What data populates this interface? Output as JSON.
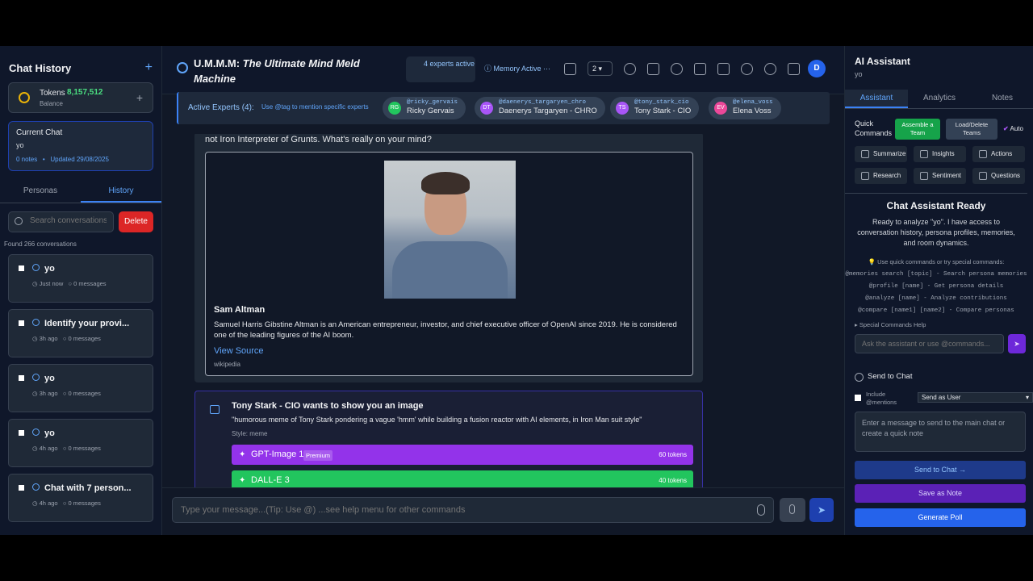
{
  "left": {
    "title": "Chat History",
    "tokens_label": "Tokens",
    "tokens_value": "8,157,512",
    "balance_label": "Balance",
    "current_chat_label": "Current Chat",
    "current_chat_name": "yo",
    "current_notes": "0 notes",
    "current_updated": "Updated 29/08/2025",
    "tab_personas": "Personas",
    "tab_history": "History",
    "search_placeholder": "Search conversations",
    "delete_label": "Delete",
    "found": "Found 266 conversations",
    "conversations": [
      {
        "title": "yo",
        "time": "Just now",
        "messages": "0 messages"
      },
      {
        "title": "Identify your provi...",
        "time": "3h ago",
        "messages": "0 messages"
      },
      {
        "title": "yo",
        "time": "3h ago",
        "messages": "0 messages"
      },
      {
        "title": "yo",
        "time": "4h ago",
        "messages": "0 messages"
      },
      {
        "title": "Chat with 7 person...",
        "time": "4h ago",
        "messages": "0 messages"
      }
    ]
  },
  "header": {
    "title_prefix": "U.M.M.M: ",
    "title_italic": "The Ultimate Mind Meld Machine",
    "experts_badge": "4 experts active",
    "memory": "Memory Active",
    "select_value": "2",
    "avatar": "D",
    "active_experts_label": "Active Experts (4):",
    "mention_hint": "Use @tag to mention specific experts",
    "experts": [
      {
        "initials": "RG",
        "tag": "@ricky_gervais",
        "name": "Ricky Gervais",
        "color": "#22c55e"
      },
      {
        "initials": "DT",
        "tag": "@daenerys_targaryen_chro",
        "name": "Daenerys Targaryen - CHRO",
        "color": "#a855f7"
      },
      {
        "initials": "TS",
        "tag": "@tony_stark_cio",
        "name": "Tony Stark - CIO",
        "color": "#a855f7"
      },
      {
        "initials": "EV",
        "tag": "@elena_voss",
        "name": "Elena Voss",
        "color": "#ec4899"
      }
    ]
  },
  "chat": {
    "msg1_text": "not Iron Interpreter of Grunts. What's really on your mind?",
    "card_name": "Sam Altman",
    "card_desc": "Samuel Harris Gibstine Altman is an American entrepreneur, investor, and chief executive officer of OpenAI since 2019. He is considered one of the leading figures of the AI boom.",
    "card_source": "View Source",
    "card_site": "wikipedia",
    "msg2_title": "Tony Stark - CIO wants to show you an image",
    "msg2_prompt": "\"humorous meme of Tony Stark pondering a vague 'hmm' while building a fusion reactor with AI elements, in Iron Man suit style\"",
    "msg2_style": "Style: meme",
    "generators": [
      {
        "name": "GPT-Image 1",
        "badge": "Premium",
        "tokens": "60 tokens",
        "color": "#9333ea"
      },
      {
        "name": "DALL-E 3",
        "badge": "",
        "tokens": "40 tokens",
        "color": "#22c55e"
      }
    ],
    "input_placeholder": "Type your message...(Tip: Use @) ...see help menu for other commands"
  },
  "right": {
    "title": "AI Assistant",
    "sub": "yo",
    "tabs": [
      "Assistant",
      "Analytics",
      "Notes"
    ],
    "quick_commands": "Quick Commands",
    "assemble": "Assemble a Team",
    "load_delete": "Load/Delete Teams",
    "auto": "Auto",
    "buttons": [
      "Summarize",
      "Insights",
      "Actions",
      "Research",
      "Sentiment",
      "Questions"
    ],
    "ready_title": "Chat Assistant Ready",
    "ready_text": "Ready to analyze \"yo\". I have access to conversation history, persona profiles, memories, and room dynamics.",
    "tip": "💡 Use quick commands or try special commands:",
    "cmd1": "@memories search [topic] - Search persona memories",
    "cmd2": "@profile [name] - Get persona details",
    "cmd3": "@analyze [name] - Analyze contributions",
    "cmd4": "@compare [name1] [name2] - Compare personas",
    "help": "▸ Special Commands Help",
    "ask_placeholder": "Ask the assistant or use @commands...",
    "send_to_chat_heading": "Send to Chat",
    "include_mentions": "Include @mentions",
    "send_as": "Send as User",
    "note_placeholder": "Enter a message to send to the main chat or create a quick note",
    "send_btn": "Send to Chat →",
    "save_btn": "Save as Note",
    "poll_btn": "Generate Poll"
  }
}
